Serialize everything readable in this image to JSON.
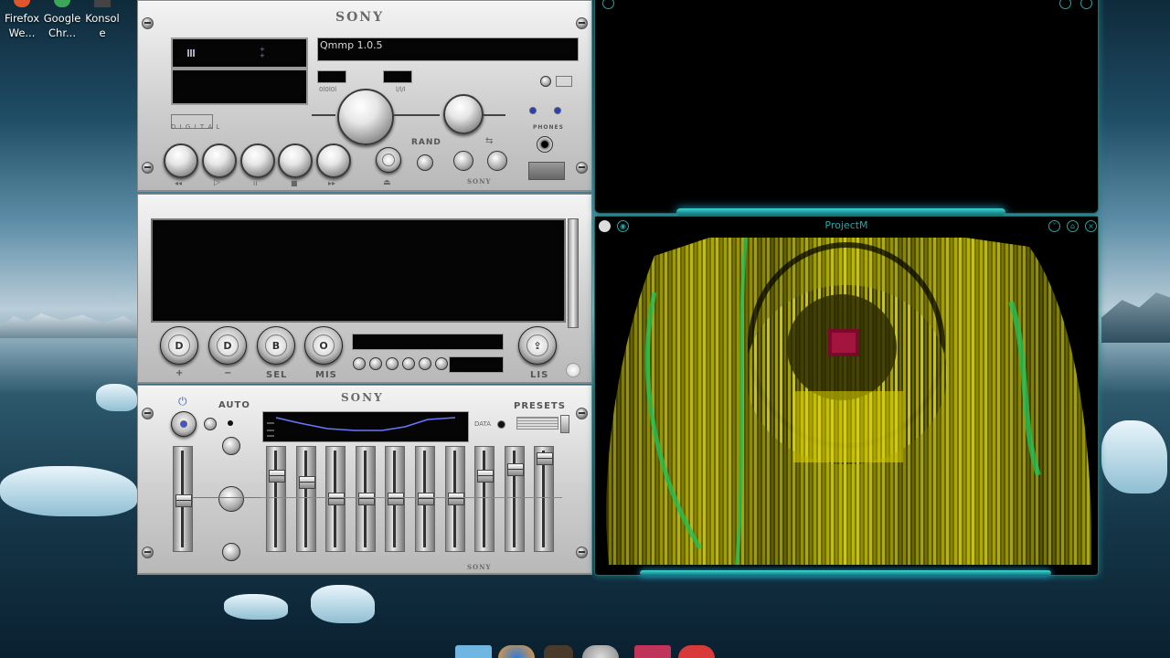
{
  "desktop": {
    "icons": [
      {
        "label_line1": "Firefox",
        "label_line2": "We..."
      },
      {
        "label_line1": "Google",
        "label_line2": "Chr..."
      },
      {
        "label_line1": "Konsol",
        "label_line2": "e"
      }
    ]
  },
  "player": {
    "brand_top": "SONY",
    "brand_eq": "SONY",
    "brand_footer": "SONY",
    "title_display": "Qmmp 1.0.5",
    "rand_label": "RAND",
    "phones_label": "PHONES",
    "playlist_buttons": [
      {
        "symbol": "D",
        "label": "+"
      },
      {
        "symbol": "D",
        "label": "−"
      },
      {
        "symbol": "B",
        "label": "SEL"
      },
      {
        "symbol": "O",
        "label": "MIS"
      }
    ],
    "list_button": {
      "symbol": "⇪",
      "label": "LIS"
    },
    "eq": {
      "auto_label": "AUTO",
      "presets_label": "PRESETS",
      "data_label": "DATA",
      "band_levels": [
        0.75,
        0.68,
        0.5,
        0.5,
        0.5,
        0.5,
        0.5,
        0.75,
        0.82,
        0.94
      ]
    }
  },
  "projectm": {
    "title": "ProjectM"
  },
  "colors": {
    "accent": "#2ba3a3",
    "viz_yellow": "#d4d000",
    "viz_green": "#22c15a"
  }
}
